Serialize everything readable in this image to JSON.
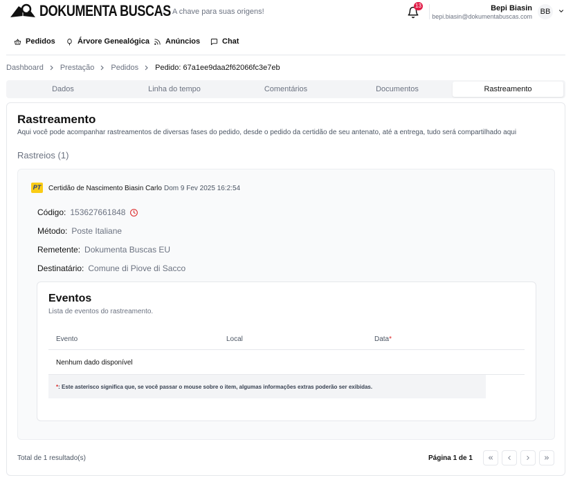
{
  "header": {
    "brand": "DOKUMENTA BUSCAS",
    "tagline": "A chave para suas origens!",
    "notification_count": "13",
    "user_name": "Bepi Biasin",
    "user_email": "bepi.biasin@dokumentabuscas.com",
    "avatar_initials": "BB"
  },
  "nav": {
    "items": [
      {
        "label": "Pedidos",
        "icon": "basket-icon"
      },
      {
        "label": "Árvore Genealógica",
        "icon": "tree-icon"
      },
      {
        "label": "Anúncios",
        "icon": "rss-icon"
      },
      {
        "label": "Chat",
        "icon": "chat-icon"
      }
    ]
  },
  "breadcrumb": {
    "items": [
      "Dashboard",
      "Prestação",
      "Pedidos"
    ],
    "current": "Pedido: 67a1ee9daa2f62066fc3e7eb"
  },
  "tabs": [
    {
      "label": "Dados",
      "active": false
    },
    {
      "label": "Linha do tempo",
      "active": false
    },
    {
      "label": "Comentários",
      "active": false
    },
    {
      "label": "Documentos",
      "active": false
    },
    {
      "label": "Rastreamento",
      "active": true
    }
  ],
  "tracking": {
    "title": "Rastreamento",
    "description": "Aqui você pode acompanhar rastreamentos de diversas fases do pedido, desde o pedido da certidão de seu antenato, até a entrega, tudo será compartilhado aqui",
    "count_label": "Rastreios (1)",
    "item": {
      "carrier_logo": "PT",
      "name": "Certidão de Nascimento Biasin Carlo",
      "date": "Dom 9 Fev 2025 16:2:54",
      "fields": {
        "codigo_label": "Código:",
        "codigo_value": "153627661848",
        "metodo_label": "Método:",
        "metodo_value": "Poste Italiane",
        "remetente_label": "Remetente:",
        "remetente_value": "Dokumenta Buscas EU",
        "destinatario_label": "Destinatário:",
        "destinatario_value": "Comune di Piove di Sacco"
      }
    },
    "events": {
      "title": "Eventos",
      "description": "Lista de eventos do rastreamento.",
      "columns": [
        "Evento",
        "Local",
        "Data"
      ],
      "asterisk": "*",
      "empty_text": "Nenhum dado disponível",
      "note_text": ": Este asterisco significa que, se você passar o mouse sobre o item, algumas informações extras poderão ser exibidas."
    }
  },
  "pagination": {
    "total": "Total de 1 resultado(s)",
    "page_info": "Página 1 de 1"
  },
  "colors": {
    "accent_red": "#dc2626",
    "badge_red": "#e11d48",
    "pt_yellow": "#facc15"
  }
}
